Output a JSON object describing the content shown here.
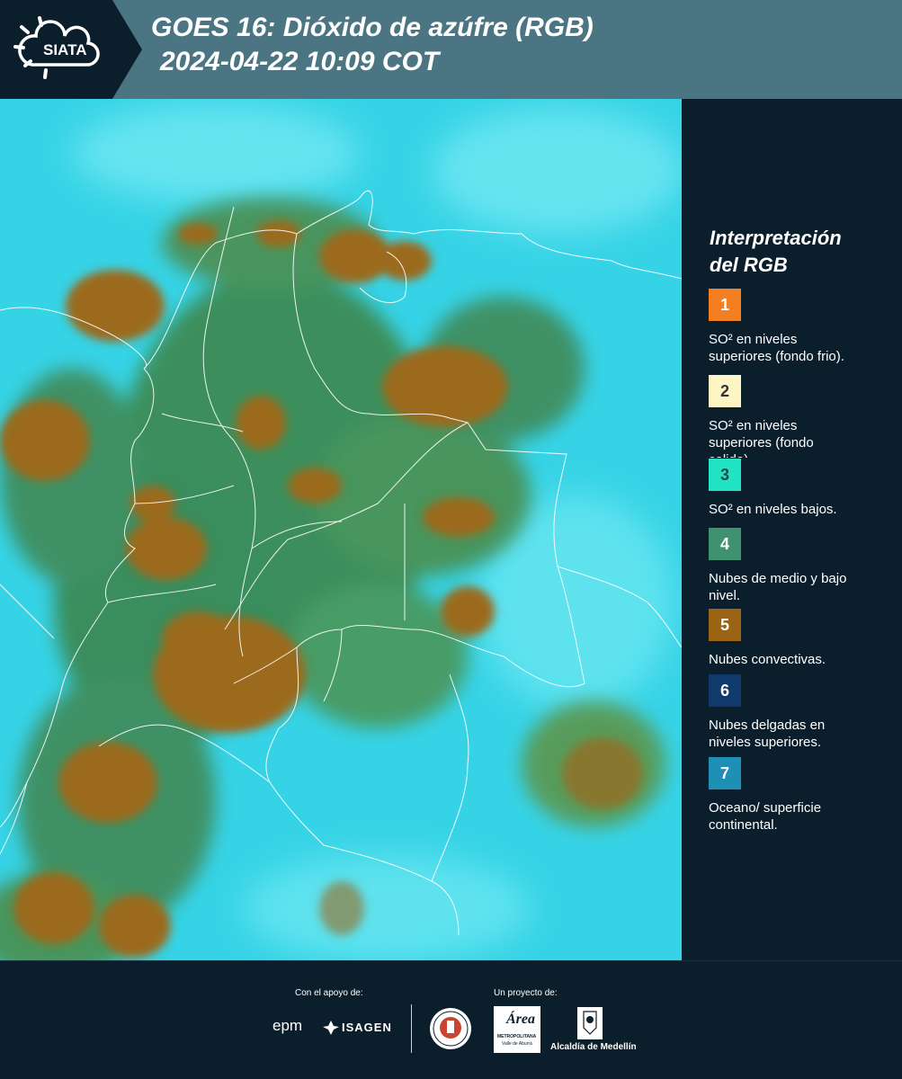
{
  "header": {
    "logo_text": "SIATA",
    "title_line1": "GOES 16: Dióxido de azúfre (RGB)",
    "title_line2": "2024-04-22 10:09 COT"
  },
  "legend": {
    "title_line1": "Interpretación",
    "title_line2": "del RGB",
    "items": [
      {
        "number": "1",
        "color": "#f47f20",
        "line1": "SO² en niveles",
        "line2": "superiores (fondo frio)."
      },
      {
        "number": "2",
        "color": "#fdf5c4",
        "line1": "SO² en niveles",
        "line2": "superiores (fondo",
        "line3": "calido)."
      },
      {
        "number": "3",
        "color": "#22e3c4",
        "line1": "SO² en niveles bajos."
      },
      {
        "number": "4",
        "color": "#3f9270",
        "line1": "Nubes de medio y bajo",
        "line2": "nivel."
      },
      {
        "number": "5",
        "color": "#9b6414",
        "line1": "Nubes convectivas."
      },
      {
        "number": "6",
        "color": "#0f3a6b",
        "line1": "Nubes delgadas en",
        "line2": "niveles superiores."
      },
      {
        "number": "7",
        "color": "#1e8fb5",
        "line1": "Oceano/ superficie",
        "line2": "continental."
      }
    ]
  },
  "footer": {
    "support_label": "Con el apoyo de:",
    "project_label": "Un proyecto de:",
    "epm": "epm",
    "isagen": "ISAGEN",
    "area_word": "Área",
    "area_sub1": "METROPOLITANA",
    "area_sub2": "Valle de Aburrá",
    "alcaldia": "Alcaldía de Medellín"
  },
  "colors": {
    "header_bg": "#4c7584",
    "panel_bg": "#0b1e2c",
    "surface_cyan": "#2fcde0",
    "convective_brown": "#9b6a1e",
    "midlevel_green": "#3f7a4a"
  }
}
